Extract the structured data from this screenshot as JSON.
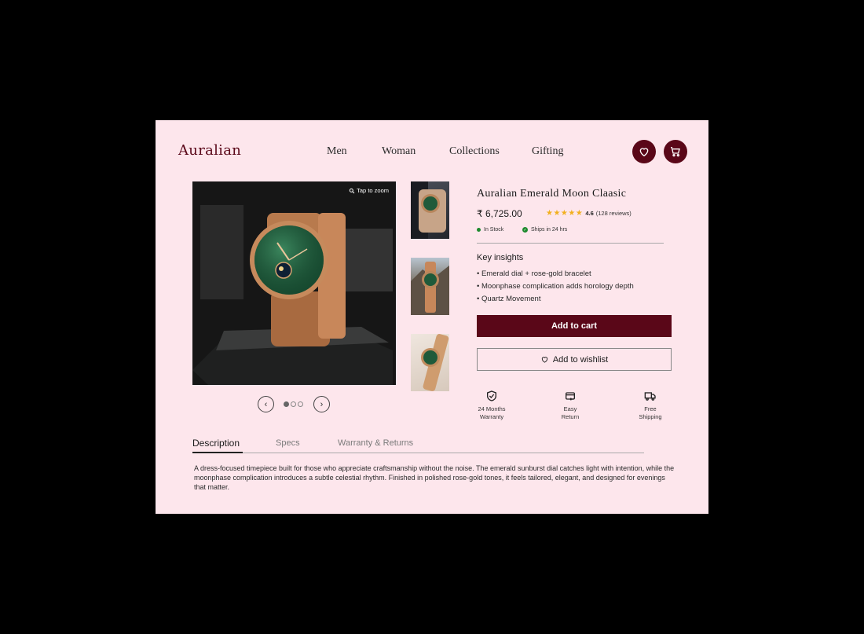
{
  "brand": {
    "name": "Auralian"
  },
  "nav": {
    "items": [
      "Men",
      "Woman",
      "Collections",
      "Gifting"
    ]
  },
  "gallery": {
    "zoom_hint": "Tap to zoom",
    "slide_count": 3,
    "active_slide": 1
  },
  "product": {
    "title": "Auralian  Emerald Moon Claasic",
    "price": "₹ 6,725.00",
    "rating": {
      "stars": "★★★★★",
      "value": "4.6",
      "reviews": "(128 reviews)"
    },
    "stock": "In Stock",
    "shipping": "Ships in 24 hrs"
  },
  "insights": {
    "title": "Key insights",
    "items": [
      "• Emerald dial + rose-gold bracelet",
      "• Moonphase complication adds horology depth",
      "• Quartz Movement"
    ]
  },
  "actions": {
    "add_to_cart": "Add to cart",
    "add_to_wishlist": "Add to wishlist"
  },
  "features": [
    {
      "icon": "shield-check-icon",
      "line1": "24 Months",
      "line2": "Warranty"
    },
    {
      "icon": "return-box-icon",
      "line1": "Easy",
      "line2": "Return"
    },
    {
      "icon": "truck-icon",
      "line1": "Free",
      "line2": "Shipping"
    }
  ],
  "tabs": [
    "Description",
    "Specs",
    "Warranty & Returns"
  ],
  "description": "A dress-focused timepiece built for those who appreciate craftsmanship without the noise. The emerald sunburst dial catches light with intention, while the moonphase complication introduces a subtle celestial rhythm. Finished in polished rose-gold tones, it feels tailored, elegant, and designed for evenings that matter.",
  "colors": {
    "background": "#fde6ec",
    "brand": "#5a0718",
    "in_stock": "#1e8a2e",
    "stars": "#f2b01e"
  }
}
